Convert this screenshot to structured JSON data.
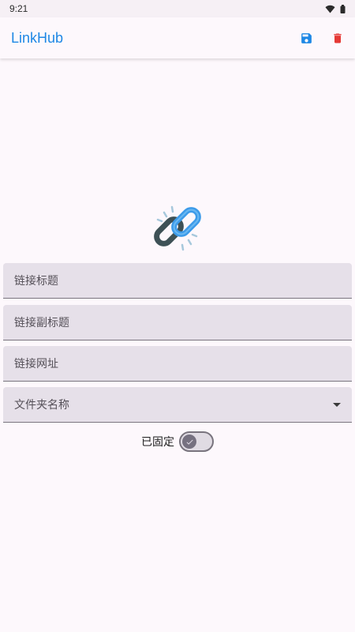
{
  "status_bar": {
    "time": "9:21",
    "icons": [
      "wifi-icon",
      "battery-icon"
    ]
  },
  "app_bar": {
    "title": "LinkHub",
    "actions": [
      {
        "icon": "save-icon",
        "color": "#1e88e5"
      },
      {
        "icon": "delete-icon",
        "color": "#e53935"
      }
    ]
  },
  "hero": {
    "icon": "link-icon"
  },
  "form": {
    "link_title": {
      "placeholder": "链接标题",
      "value": ""
    },
    "link_subtitle": {
      "placeholder": "链接副标题",
      "value": ""
    },
    "link_url": {
      "placeholder": "链接网址",
      "value": ""
    },
    "folder_name": {
      "placeholder": "文件夹名称",
      "value": ""
    },
    "pinned": {
      "label": "已固定",
      "checked": true
    }
  },
  "colors": {
    "accent": "#1e88e5",
    "danger": "#e53935",
    "field_bg": "#e6e0e9",
    "background": "#fdf8fc"
  }
}
